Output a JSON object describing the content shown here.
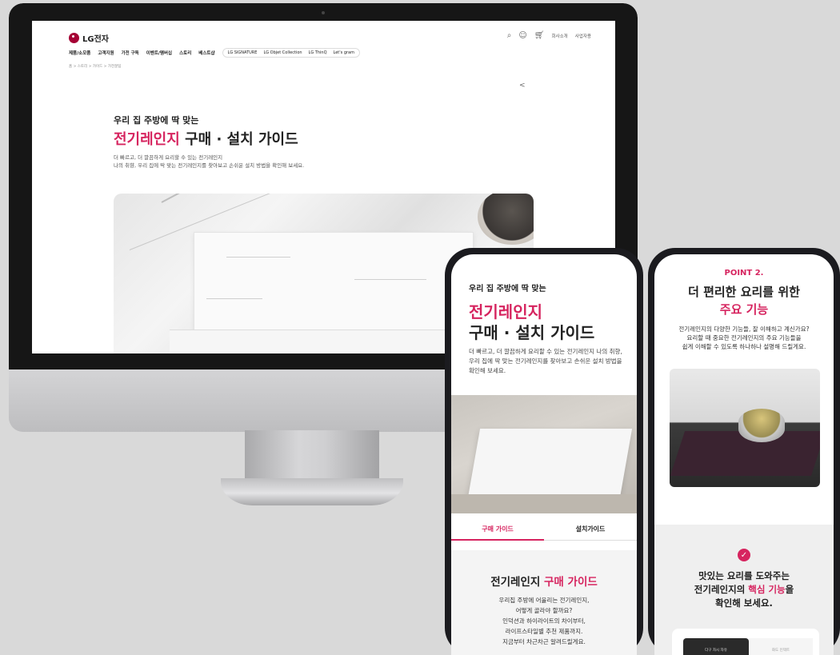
{
  "desktop": {
    "logo_text": "LG전자",
    "nav": [
      "제품/소모품",
      "고객지원",
      "가전 구독",
      "이벤트/멤버십",
      "스토리",
      "베스트샵"
    ],
    "brand_pills": [
      "LG SIGNATURE",
      "LG Objet Collection",
      "LG ThinQ",
      "Let's gram"
    ],
    "util_links": [
      "회사소개",
      "사업자용"
    ],
    "breadcrumb": "홈 > 스토리 > 가이드 > 가전꿀팁",
    "hero_subtitle": "우리 집 주방에 딱 맞는",
    "hero_title_highlight": "전기레인지",
    "hero_title_rest": " 구매 · 설치 가이드",
    "hero_desc_line1": "더 빠르고, 더 깔끔하게 요리할 수 있는 전기레인지",
    "hero_desc_line2": "나의 취향, 우리 집에 딱 맞는 전기레인지를 찾아보고 손쉬운 설치 방법을 확인해 보세요."
  },
  "phone1": {
    "subtitle": "우리 집 주방에 딱 맞는",
    "title_highlight": "전기레인지",
    "title_rest": "구매 · 설치 가이드",
    "desc": "더 빠르고, 더 깔끔하게 요리할 수 있는 전기레인지 나의 취향, 우리 집에 딱 맞는 전기레인지를 찾아보고 손쉬운 설치 방법을 확인해 보세요.",
    "tabs": [
      "구매 가이드",
      "설치가이드"
    ],
    "section_title_prefix": "전기레인지 ",
    "section_title_highlight": "구매 가이드",
    "section_desc": [
      "우리집 주방에 어울리는 전기레인지,",
      "어떻게 골라야 할까요?",
      "인덕션과 하이라이트의 차이부터,",
      "라이프스타일별 추천 제품까지.",
      "지금부터 차근차근 알려드릴게요."
    ]
  },
  "phone2": {
    "point_label": "POINT 2.",
    "title_line1": "더 편리한 요리를 위한",
    "title_line2": "주요 기능",
    "desc": [
      "전기레인지의 다양한 기능들, 잘 이해하고 계신가요?",
      "요리할 때 중요한 전기레인지의 주요 기능들을",
      "쉽게 이해할 수 있도록 하나하나 설명해 드릴게요."
    ],
    "q_line1": "맛있는 요리를 도와주는",
    "q_line2_prefix": "전기레인지의 ",
    "q_line2_highlight": "핵심 기능",
    "q_line2_suffix": "을",
    "q_line3": "확인해 보세요.",
    "card_tabs": [
      "다구 자시 자유",
      "화도 인덱트"
    ]
  },
  "colors": {
    "accent": "#d6245f",
    "brand": "#a50034"
  }
}
